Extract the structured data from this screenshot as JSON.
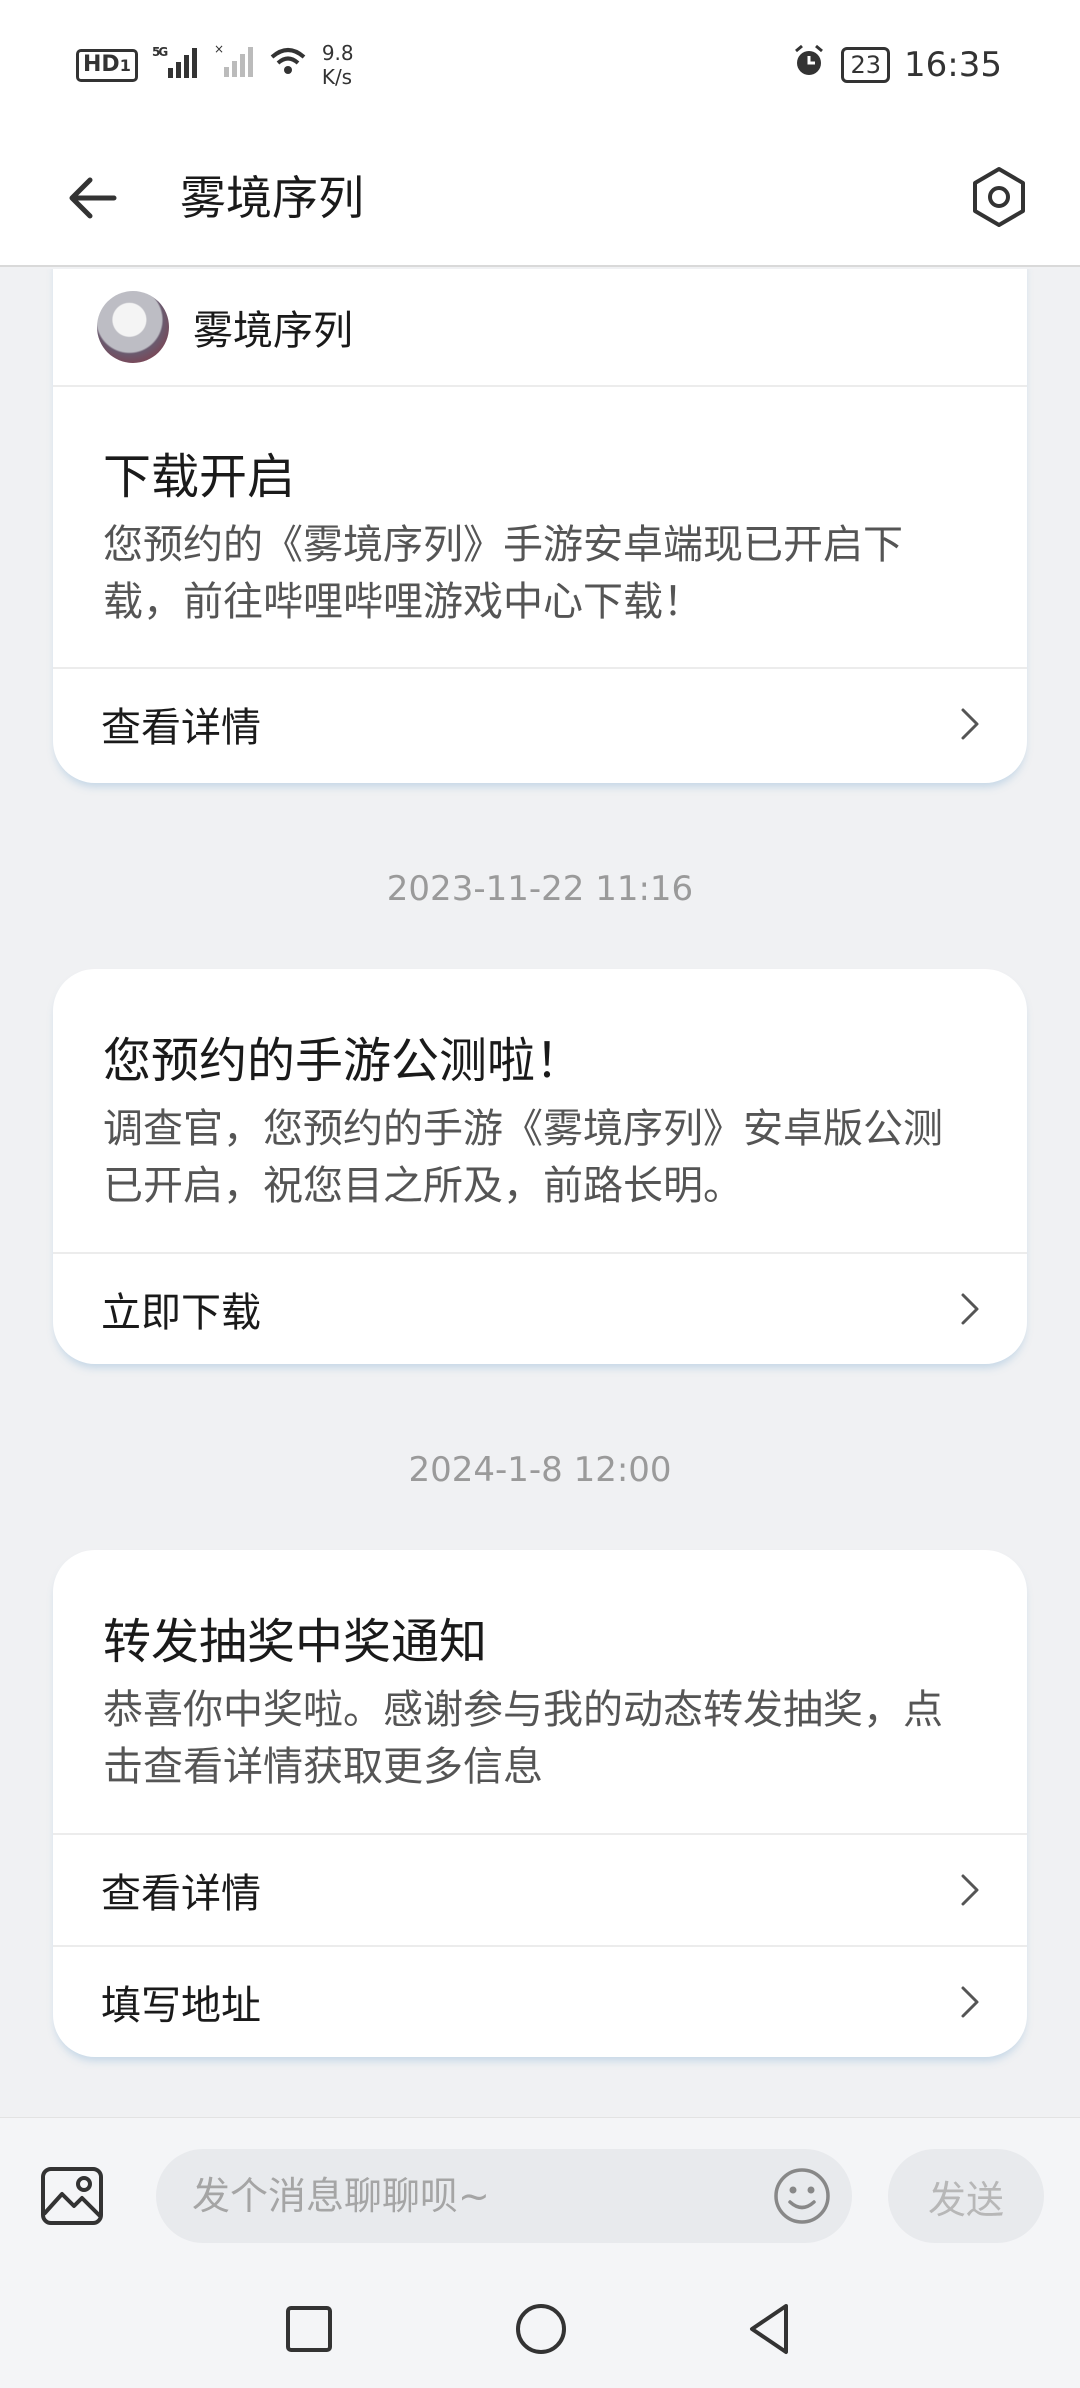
{
  "status_bar": {
    "hd": "HD",
    "hd_sub": "1",
    "signal1": "5G",
    "speed_value": "9.8",
    "speed_unit": "K/s",
    "battery": "23",
    "time": "16:35"
  },
  "header": {
    "title": "雾境序列",
    "back_icon": "arrow-left-icon",
    "settings_icon": "hexagon-gear-icon"
  },
  "messages": [
    {
      "sender": "雾境序列",
      "title": "下载开启",
      "text": "您预约的《雾境序列》手游安卓端现已开启下载，前往哔哩哔哩游戏中心下载！",
      "actions": [
        "查看详情"
      ]
    },
    {
      "timestamp": "2023-11-22 11:16",
      "title": "您预约的手游公测啦！",
      "text": "调查官，您预约的手游《雾境序列》安卓版公测已开启，祝您目之所及，前路长明。",
      "actions": [
        "立即下载"
      ]
    },
    {
      "timestamp": "2024-1-8 12:00",
      "title": "转发抽奖中奖通知",
      "text": "恭喜你中奖啦。感谢参与我的动态转发抽奖，点击查看详情获取更多信息",
      "actions": [
        "查看详情",
        "填写地址"
      ]
    }
  ],
  "input_bar": {
    "placeholder": "发个消息聊聊呗~",
    "value": "",
    "send_label": "发送",
    "image_icon": "image-icon",
    "emoji_icon": "emoji-icon"
  },
  "nav": {
    "recent_icon": "square-icon",
    "home_icon": "circle-icon",
    "back_icon": "triangle-back-icon"
  }
}
